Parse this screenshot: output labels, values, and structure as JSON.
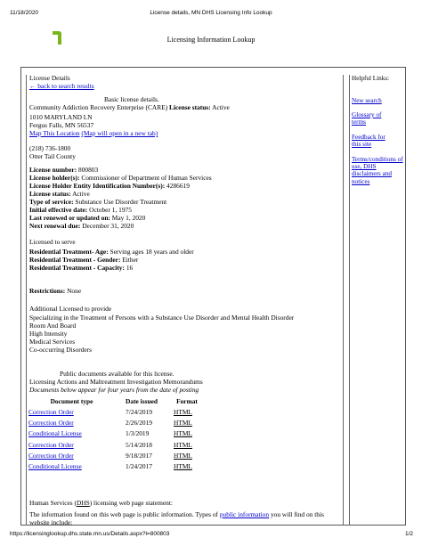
{
  "print_header": {
    "date": "11/18/2020",
    "title": "License details, MN DHS Licensing Info Lookup"
  },
  "site_title": "Licensing Information Lookup",
  "license": {
    "details_label": "License Details",
    "back_link": "← back to search results",
    "basic_details": "Basic license details.",
    "program_name": "Community Addiction Recovery Enterprise (CARE)",
    "status_label": "License status:",
    "status_value": "Active",
    "address_line1": "1010 MARYLAND LN",
    "address_line2": "Fergus Falls, MN 56537",
    "map_link": "Map This Location",
    "map_new_tab": "(Map will open in a new tab)",
    "phone": "(218) 736-1800",
    "county": "Otter Tail County",
    "fields": [
      {
        "label": "License number:",
        "value": "800803"
      },
      {
        "label": "License holder(s):",
        "value": "Commissioner of Department of Human Services"
      },
      {
        "label": "License Holder Entity Identification Number(s):",
        "value": "4286619"
      },
      {
        "label": "License status:",
        "value": "Active"
      },
      {
        "label": "Type of service:",
        "value": "Substance Use Disorder Treatment"
      },
      {
        "label": "Initial effective date:",
        "value": "October 1, 1975"
      },
      {
        "label": "Last renewed or updated on:",
        "value": "May 1, 2020"
      },
      {
        "label": "Next renewal due:",
        "value": "December 31, 2020"
      }
    ],
    "licensed_to_serve": "Licensed to serve",
    "serve_fields": [
      {
        "label": "Residential Treatment- Age:",
        "value": "Serving ages 18 years and older"
      },
      {
        "label": "Residential Treatment - Gender:",
        "value": "Either"
      },
      {
        "label": "Residential Treatment - Capacity:",
        "value": "16"
      }
    ],
    "restrictions_label": "Restrictions:",
    "restrictions_value": "None",
    "additional_label": "Additional Licensed to provide",
    "additional_items": [
      "Specializing in the Treatment of Persons with a Substance Use Disorder and Mental Health Disorder",
      "Room And Board",
      "High Intensity",
      "Medical Services",
      "Co-occurring Disorders"
    ]
  },
  "documents": {
    "available_text": "Public documents available for this license.",
    "section_title": "Licensing Actions and Maltreatment Investigation Memorandums",
    "note": "Documents below appear for four years from the date of posting",
    "headers": [
      "Document type",
      "Date issued",
      "Format"
    ],
    "rows": [
      {
        "type": "Correction Order",
        "date": "7/24/2019",
        "format": "HTML"
      },
      {
        "type": "Correction Order",
        "date": "2/26/2019",
        "format": "HTML"
      },
      {
        "type": "Conditional License",
        "date": "1/3/2019",
        "format": "HTML"
      },
      {
        "type": "Correction Order",
        "date": "5/14/2018",
        "format": "HTML"
      },
      {
        "type": "Correction Order",
        "date": "9/18/2017",
        "format": "HTML"
      },
      {
        "type": "Conditional License",
        "date": "1/24/2017",
        "format": "HTML"
      }
    ]
  },
  "statement": {
    "line1_prefix": "Human Services (",
    "line1_abbr": "DHS",
    "line1_suffix": ") licensing web page statement:",
    "line2_prefix": "The information found on this web page is public information. Types of",
    "line2_link": "public information",
    "line2_suffix": "you will find on this",
    "line3": "website include:"
  },
  "sidebar": {
    "title": "Helpful Links:",
    "links": [
      {
        "text": "New search"
      },
      {
        "text": "Glossary of terms"
      },
      {
        "text": "Feedback for this site"
      },
      {
        "text": "Terms/conditions of use, DHS disclaimers and notices"
      }
    ]
  },
  "print_footer": {
    "url": "https://licensinglookup.dhs.state.mn.us/Details.aspx?l=800803",
    "page": "1/2"
  },
  "colors": {
    "link": "#0000cc",
    "logo": "#7ab51d"
  }
}
